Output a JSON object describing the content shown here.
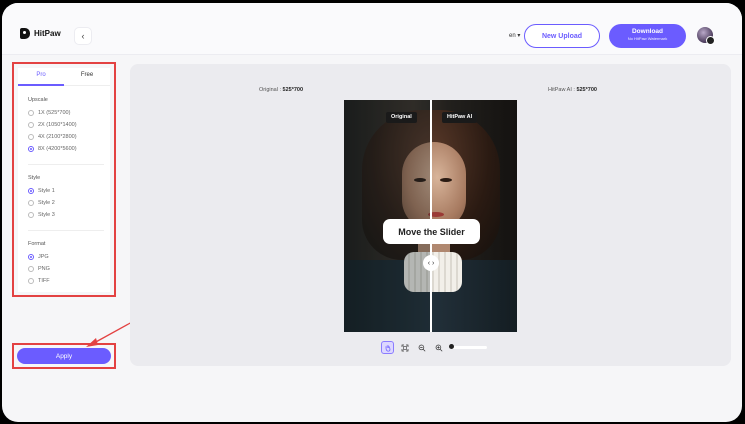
{
  "header": {
    "brand": "HitPaw",
    "back_icon": "chevron-left-icon",
    "language": "en ▾",
    "new_upload_label": "New Upload",
    "download_label": "Download",
    "download_sub": "No HitPaw Watermark"
  },
  "sidebar": {
    "tabs": [
      {
        "label": "Pro",
        "active": true
      },
      {
        "label": "Free",
        "active": false
      }
    ],
    "upscale": {
      "title": "Upscale",
      "options": [
        {
          "label": "1X (525*700)",
          "selected": false
        },
        {
          "label": "2X (1050*1400)",
          "selected": false
        },
        {
          "label": "4X (2100*2800)",
          "selected": false
        },
        {
          "label": "8X (4200*5600)",
          "selected": true
        }
      ]
    },
    "style": {
      "title": "Style",
      "options": [
        {
          "label": "Style 1",
          "selected": true
        },
        {
          "label": "Style 2",
          "selected": false
        },
        {
          "label": "Style 3",
          "selected": false
        }
      ]
    },
    "format": {
      "title": "Format",
      "options": [
        {
          "label": "JPG",
          "selected": true
        },
        {
          "label": "PNG",
          "selected": false
        },
        {
          "label": "TIFF",
          "selected": false
        }
      ]
    },
    "apply_label": "Apply"
  },
  "preview": {
    "original_label": "Original :",
    "original_size": "525*700",
    "result_label": "HitPaw AI :",
    "result_size": "525*700",
    "tag_original": "Original",
    "tag_result": "HitPaw AI",
    "slider_tip": "Move the Slider",
    "handle_glyph": "‹ ›",
    "split_position": 0.5,
    "zoom_level": 0
  },
  "toolbar": {
    "tools": [
      "hand-icon",
      "fit-screen-icon",
      "zoom-out-icon",
      "zoom-in-icon"
    ]
  },
  "colors": {
    "accent": "#6b5cff",
    "highlight": "#e34242",
    "background": "#f6f6f8"
  }
}
